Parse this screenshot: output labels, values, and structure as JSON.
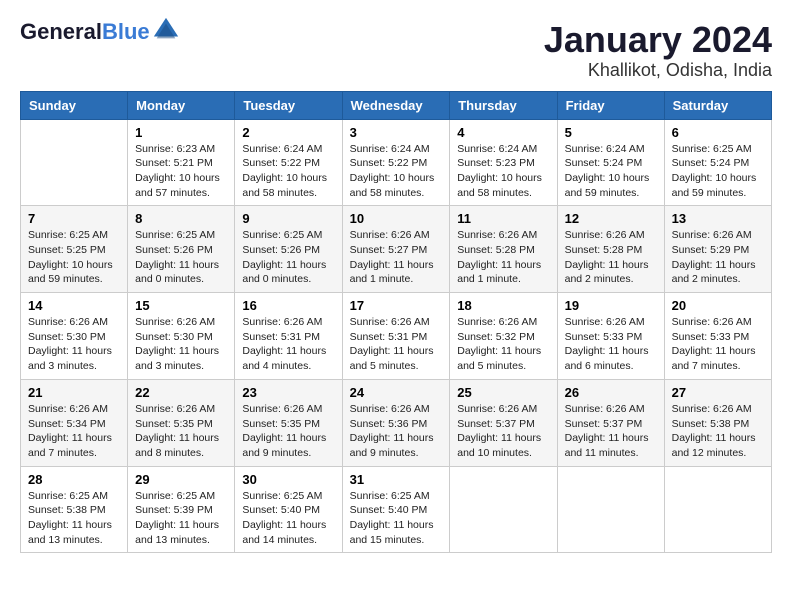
{
  "logo": {
    "line1": "General",
    "line2": "Blue"
  },
  "title": "January 2024",
  "subtitle": "Khallikot, Odisha, India",
  "days_of_week": [
    "Sunday",
    "Monday",
    "Tuesday",
    "Wednesday",
    "Thursday",
    "Friday",
    "Saturday"
  ],
  "weeks": [
    [
      {
        "day": "",
        "info": ""
      },
      {
        "day": "1",
        "info": "Sunrise: 6:23 AM\nSunset: 5:21 PM\nDaylight: 10 hours\nand 57 minutes."
      },
      {
        "day": "2",
        "info": "Sunrise: 6:24 AM\nSunset: 5:22 PM\nDaylight: 10 hours\nand 58 minutes."
      },
      {
        "day": "3",
        "info": "Sunrise: 6:24 AM\nSunset: 5:22 PM\nDaylight: 10 hours\nand 58 minutes."
      },
      {
        "day": "4",
        "info": "Sunrise: 6:24 AM\nSunset: 5:23 PM\nDaylight: 10 hours\nand 58 minutes."
      },
      {
        "day": "5",
        "info": "Sunrise: 6:24 AM\nSunset: 5:24 PM\nDaylight: 10 hours\nand 59 minutes."
      },
      {
        "day": "6",
        "info": "Sunrise: 6:25 AM\nSunset: 5:24 PM\nDaylight: 10 hours\nand 59 minutes."
      }
    ],
    [
      {
        "day": "7",
        "info": "Sunrise: 6:25 AM\nSunset: 5:25 PM\nDaylight: 10 hours\nand 59 minutes."
      },
      {
        "day": "8",
        "info": "Sunrise: 6:25 AM\nSunset: 5:26 PM\nDaylight: 11 hours\nand 0 minutes."
      },
      {
        "day": "9",
        "info": "Sunrise: 6:25 AM\nSunset: 5:26 PM\nDaylight: 11 hours\nand 0 minutes."
      },
      {
        "day": "10",
        "info": "Sunrise: 6:26 AM\nSunset: 5:27 PM\nDaylight: 11 hours\nand 1 minute."
      },
      {
        "day": "11",
        "info": "Sunrise: 6:26 AM\nSunset: 5:28 PM\nDaylight: 11 hours\nand 1 minute."
      },
      {
        "day": "12",
        "info": "Sunrise: 6:26 AM\nSunset: 5:28 PM\nDaylight: 11 hours\nand 2 minutes."
      },
      {
        "day": "13",
        "info": "Sunrise: 6:26 AM\nSunset: 5:29 PM\nDaylight: 11 hours\nand 2 minutes."
      }
    ],
    [
      {
        "day": "14",
        "info": "Sunrise: 6:26 AM\nSunset: 5:30 PM\nDaylight: 11 hours\nand 3 minutes."
      },
      {
        "day": "15",
        "info": "Sunrise: 6:26 AM\nSunset: 5:30 PM\nDaylight: 11 hours\nand 3 minutes."
      },
      {
        "day": "16",
        "info": "Sunrise: 6:26 AM\nSunset: 5:31 PM\nDaylight: 11 hours\nand 4 minutes."
      },
      {
        "day": "17",
        "info": "Sunrise: 6:26 AM\nSunset: 5:31 PM\nDaylight: 11 hours\nand 5 minutes."
      },
      {
        "day": "18",
        "info": "Sunrise: 6:26 AM\nSunset: 5:32 PM\nDaylight: 11 hours\nand 5 minutes."
      },
      {
        "day": "19",
        "info": "Sunrise: 6:26 AM\nSunset: 5:33 PM\nDaylight: 11 hours\nand 6 minutes."
      },
      {
        "day": "20",
        "info": "Sunrise: 6:26 AM\nSunset: 5:33 PM\nDaylight: 11 hours\nand 7 minutes."
      }
    ],
    [
      {
        "day": "21",
        "info": "Sunrise: 6:26 AM\nSunset: 5:34 PM\nDaylight: 11 hours\nand 7 minutes."
      },
      {
        "day": "22",
        "info": "Sunrise: 6:26 AM\nSunset: 5:35 PM\nDaylight: 11 hours\nand 8 minutes."
      },
      {
        "day": "23",
        "info": "Sunrise: 6:26 AM\nSunset: 5:35 PM\nDaylight: 11 hours\nand 9 minutes."
      },
      {
        "day": "24",
        "info": "Sunrise: 6:26 AM\nSunset: 5:36 PM\nDaylight: 11 hours\nand 9 minutes."
      },
      {
        "day": "25",
        "info": "Sunrise: 6:26 AM\nSunset: 5:37 PM\nDaylight: 11 hours\nand 10 minutes."
      },
      {
        "day": "26",
        "info": "Sunrise: 6:26 AM\nSunset: 5:37 PM\nDaylight: 11 hours\nand 11 minutes."
      },
      {
        "day": "27",
        "info": "Sunrise: 6:26 AM\nSunset: 5:38 PM\nDaylight: 11 hours\nand 12 minutes."
      }
    ],
    [
      {
        "day": "28",
        "info": "Sunrise: 6:25 AM\nSunset: 5:38 PM\nDaylight: 11 hours\nand 13 minutes."
      },
      {
        "day": "29",
        "info": "Sunrise: 6:25 AM\nSunset: 5:39 PM\nDaylight: 11 hours\nand 13 minutes."
      },
      {
        "day": "30",
        "info": "Sunrise: 6:25 AM\nSunset: 5:40 PM\nDaylight: 11 hours\nand 14 minutes."
      },
      {
        "day": "31",
        "info": "Sunrise: 6:25 AM\nSunset: 5:40 PM\nDaylight: 11 hours\nand 15 minutes."
      },
      {
        "day": "",
        "info": ""
      },
      {
        "day": "",
        "info": ""
      },
      {
        "day": "",
        "info": ""
      }
    ]
  ]
}
